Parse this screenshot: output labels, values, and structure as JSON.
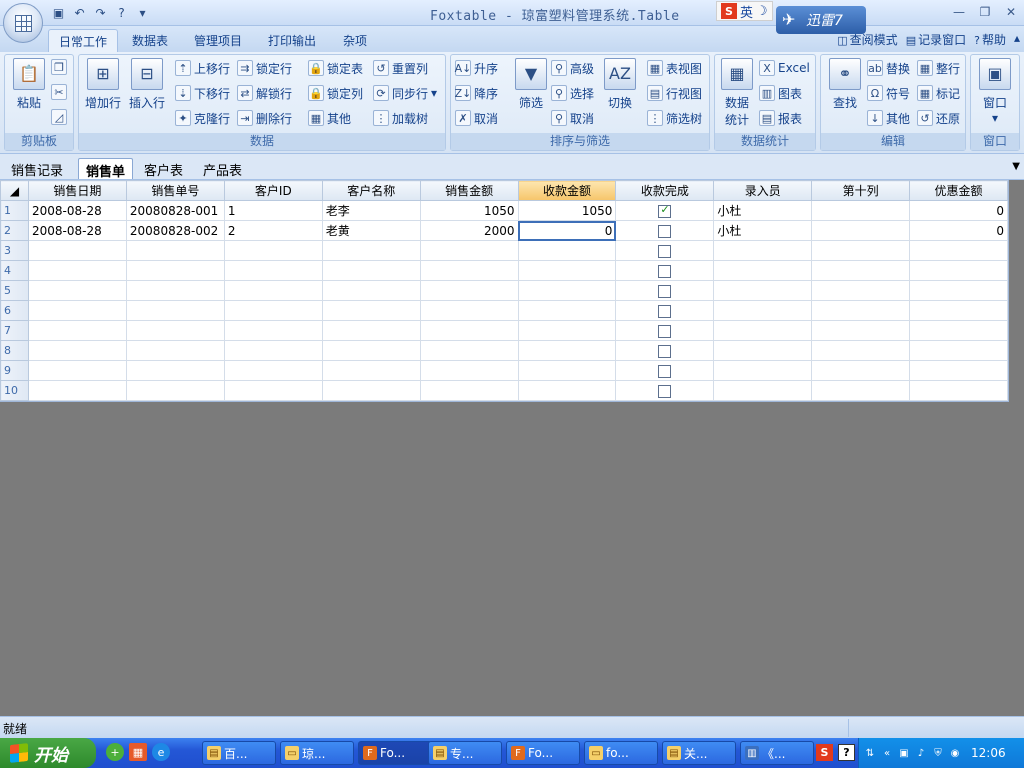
{
  "title_bar": {
    "title": "Foxtable - 琼富塑料管理系统.Table",
    "ime_label": "英",
    "xunlei_label": "迅雷7"
  },
  "ribbon": {
    "tabs": [
      "日常工作",
      "数据表",
      "管理项目",
      "打印输出",
      "杂项"
    ],
    "active_tab": 0,
    "right_links": [
      "查阅模式",
      "记录窗口",
      "帮助"
    ],
    "groups": {
      "clipboard": {
        "label": "剪贴板",
        "paste": "粘贴"
      },
      "data": {
        "label": "数据",
        "add_row": "增加行",
        "insert_row": "插入行",
        "move_up": "上移行",
        "move_down": "下移行",
        "clone_row": "克隆行",
        "lock_row": "锁定行",
        "unlock_row": "解锁行",
        "delete_row": "删除行",
        "lock_table": "锁定表",
        "lock_col": "锁定列",
        "other": "其他",
        "reset_col": "重置列",
        "sync_row": "同步行",
        "load_tree": "加载树"
      },
      "sort_filter": {
        "label": "排序与筛选",
        "asc": "升序",
        "desc": "降序",
        "cancel_sort": "取消",
        "filter": "筛选",
        "advanced": "高级",
        "select": "选择",
        "cancel_filter": "取消",
        "toggle": "切换",
        "table_view": "表视图",
        "row_view": "行视图",
        "filter_tree": "筛选树"
      },
      "stats": {
        "label": "数据统计",
        "data_stats_1": "数据",
        "data_stats_2": "统计",
        "excel": "Excel",
        "chart": "图表",
        "report": "报表"
      },
      "edit": {
        "label": "编辑",
        "find": "查找",
        "replace": "替换",
        "symbol": "符号",
        "other": "其他",
        "whole_row": "整行",
        "mark": "标记",
        "restore": "还原"
      },
      "window": {
        "label": "窗口",
        "window": "窗口"
      }
    }
  },
  "sheet_tabs": [
    "销售记录",
    "销售单",
    "客户表",
    "产品表"
  ],
  "active_sheet": 1,
  "table": {
    "columns": [
      "销售日期",
      "销售单号",
      "客户ID",
      "客户名称",
      "销售金额",
      "收款金额",
      "收款完成",
      "录入员",
      "第十列",
      "优惠金额"
    ],
    "highlighted_column": 5,
    "row_numbers": [
      "1",
      "2",
      "3",
      "4",
      "5",
      "6",
      "7",
      "8",
      "9",
      "10"
    ],
    "rows": [
      {
        "date": "2008-08-28",
        "order_no": "20080828-001",
        "customer_id": "1",
        "customer_name": "老李",
        "sales_amount": "1050",
        "received_amount": "1050",
        "completed": true,
        "entered_by": "小杜",
        "col10": "",
        "discount": "0"
      },
      {
        "date": "2008-08-28",
        "order_no": "20080828-002",
        "customer_id": "2",
        "customer_name": "老黄",
        "sales_amount": "2000",
        "received_amount": "0",
        "completed": false,
        "entered_by": "小杜",
        "col10": "",
        "discount": "0"
      }
    ],
    "selected_cell": {
      "row": 1,
      "col": 5
    }
  },
  "status_bar": {
    "text": "就绪"
  },
  "taskbar": {
    "start_label": "开始",
    "tasks": [
      "百...",
      "琼...",
      "Fo...",
      "专...",
      "Fo...",
      "fo...",
      "关...",
      "《..."
    ],
    "active_task": 2,
    "clock": "12:06"
  },
  "colors": {
    "ribbon_bg": "#dbe7f6",
    "workspace_bg": "#7b7b7b",
    "header_highlight": "#f6c56a",
    "taskbar_blue": "#2457d6",
    "start_green": "#2e8a2c"
  }
}
